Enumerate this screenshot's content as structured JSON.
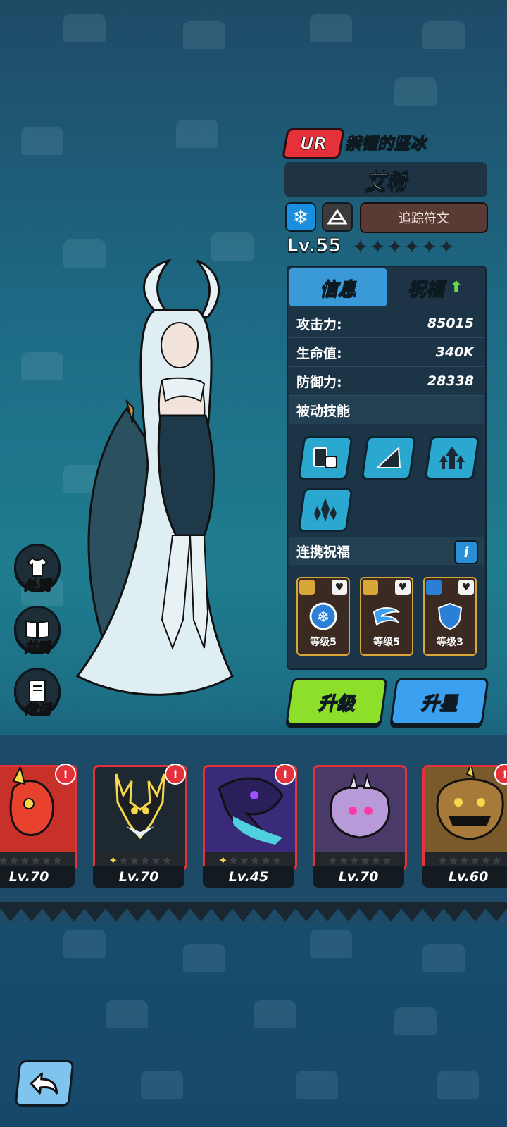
{
  "hero": {
    "rarity": "UR",
    "title": "禁锢的坚冰",
    "name": "艾希",
    "element_icon": "snowflake-icon",
    "class_icon": "triangle-icon",
    "rune_label": "追踪符文",
    "level": "Lv.55",
    "stars_total": 6
  },
  "tabs": {
    "info": "信息",
    "bless": "祝福"
  },
  "stats": [
    {
      "label": "攻击力:",
      "value": "85015"
    },
    {
      "label": "生命值:",
      "value": "340K"
    },
    {
      "label": "防御力:",
      "value": "28338"
    }
  ],
  "passive_title": "被动技能",
  "skills": [
    "cards-dice-icon",
    "ice-shard-icon",
    "arrows-up-icon",
    "ice-crystal-icon"
  ],
  "link_bless": {
    "title": "连携祝福",
    "info": "i",
    "items": [
      {
        "icon": "frost-orb-icon",
        "level": "等级5"
      },
      {
        "icon": "blizzard-icon",
        "level": "等级5"
      },
      {
        "icon": "ice-shield-icon",
        "level": "等级3"
      }
    ]
  },
  "buttons": {
    "upgrade": "升级",
    "star_up": "升星"
  },
  "side_menu": [
    {
      "icon": "shirt-icon",
      "label": "外观"
    },
    {
      "icon": "book-icon",
      "label": "共鸣"
    },
    {
      "icon": "journal-icon",
      "label": "传记"
    }
  ],
  "pets": [
    {
      "name_icon": "red-dragon-icon",
      "level": "Lv.70",
      "stars": 0,
      "alert": "!",
      "color": "#c8302a"
    },
    {
      "name_icon": "antler-beast-icon",
      "level": "Lv.70",
      "stars": 1,
      "alert": "!",
      "color": "#1e2830"
    },
    {
      "name_icon": "shadow-dragon-icon",
      "level": "Lv.45",
      "stars": 1,
      "alert": "!",
      "color": "#3a2a7a"
    },
    {
      "name_icon": "ghost-icon",
      "level": "Lv.70",
      "stars": 0,
      "alert": "",
      "color": "#4a3a6a"
    },
    {
      "name_icon": "pumpkin-beast-icon",
      "level": "Lv.60",
      "stars": 0,
      "alert": "!",
      "color": "#7a5a2a"
    }
  ],
  "colors": {
    "accent_blue": "#3a9ad8",
    "upgrade_green": "#8ddf2a",
    "star_blue": "#3aa0ef",
    "rarity_red": "#e5313a"
  }
}
